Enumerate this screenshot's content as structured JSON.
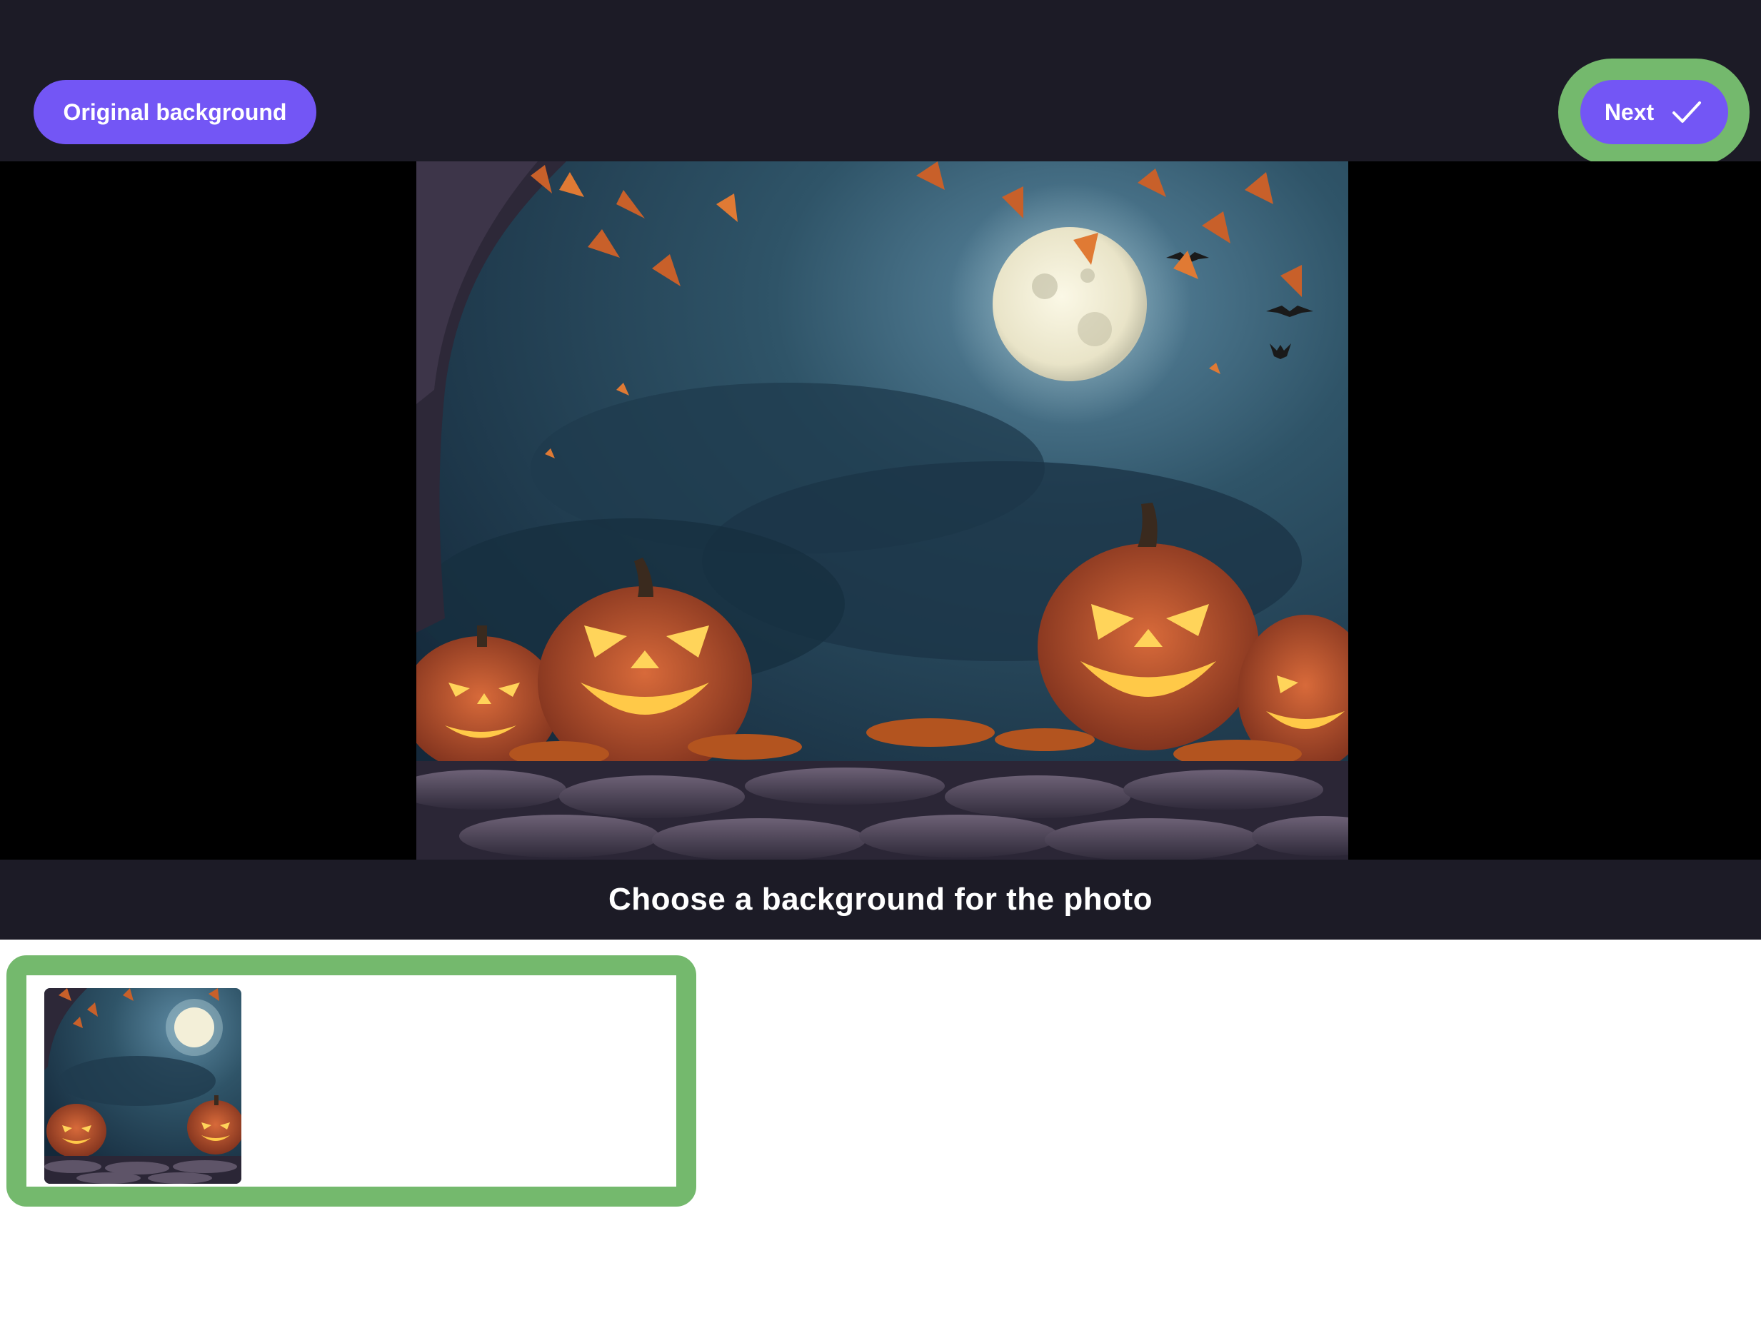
{
  "toolbar": {
    "original_background_label": "Original background",
    "next_label": "Next",
    "next_icon": "checkmark-icon"
  },
  "caption": {
    "text": "Choose a background for the photo"
  },
  "backgrounds": {
    "selected_index": 0,
    "items": [
      {
        "name": "halloween-pumpkins-moonlit-night",
        "selected": true
      }
    ]
  },
  "colors": {
    "accent": "#7356f5",
    "highlight": "#74b96d",
    "bar": "#1c1b26",
    "preview_bg": "#000000"
  }
}
